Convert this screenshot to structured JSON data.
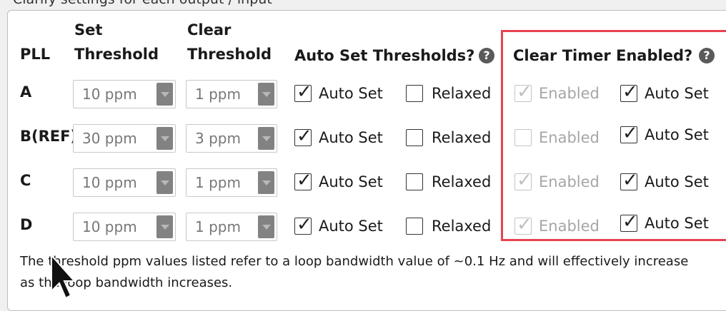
{
  "top_strip_text": "Clarify settings for each output / input",
  "headers": {
    "pll": "PLL",
    "set_line1": "Set",
    "set_line2": "Threshold",
    "clear_line1": "Clear",
    "clear_line2": "Threshold",
    "auto_set_thresholds": "Auto Set Thresholds?",
    "clear_timer_enabled": "Clear Timer Enabled?",
    "help_glyph": "?"
  },
  "rows": [
    {
      "pll": "A",
      "set_threshold": "10 ppm",
      "clear_threshold": "1 ppm",
      "auto_set_label": "Auto Set",
      "auto_set_checked": true,
      "relaxed_label": "Relaxed",
      "relaxed_checked": false,
      "timer_enabled_label": "Enabled",
      "timer_enabled_checked": true,
      "timer_enabled_disabled": true,
      "timer_auto_label": "Auto Set",
      "timer_auto_checked": true
    },
    {
      "pll": "B(REF)",
      "set_threshold": "30 ppm",
      "clear_threshold": "3 ppm",
      "auto_set_label": "Auto Set",
      "auto_set_checked": true,
      "relaxed_label": "Relaxed",
      "relaxed_checked": false,
      "timer_enabled_label": "Enabled",
      "timer_enabled_checked": false,
      "timer_enabled_disabled": true,
      "timer_auto_label": "Auto Set",
      "timer_auto_checked": true
    },
    {
      "pll": "C",
      "set_threshold": "10 ppm",
      "clear_threshold": "1 ppm",
      "auto_set_label": "Auto Set",
      "auto_set_checked": true,
      "relaxed_label": "Relaxed",
      "relaxed_checked": false,
      "timer_enabled_label": "Enabled",
      "timer_enabled_checked": true,
      "timer_enabled_disabled": true,
      "timer_auto_label": "Auto Set",
      "timer_auto_checked": true
    },
    {
      "pll": "D",
      "set_threshold": "10 ppm",
      "clear_threshold": "1 ppm",
      "auto_set_label": "Auto Set",
      "auto_set_checked": true,
      "relaxed_label": "Relaxed",
      "relaxed_checked": false,
      "timer_enabled_label": "Enabled",
      "timer_enabled_checked": true,
      "timer_enabled_disabled": true,
      "timer_auto_label": "Auto Set",
      "timer_auto_checked": true
    }
  ],
  "footnote": "The threshold ppm values listed refer to a loop bandwidth value of ~0.1 Hz and will effectively increase as the loop bandwidth increases.",
  "colors": {
    "highlight_border": "#e8434f",
    "combo_button": "#828282",
    "disabled_text": "#a6a6a6"
  }
}
